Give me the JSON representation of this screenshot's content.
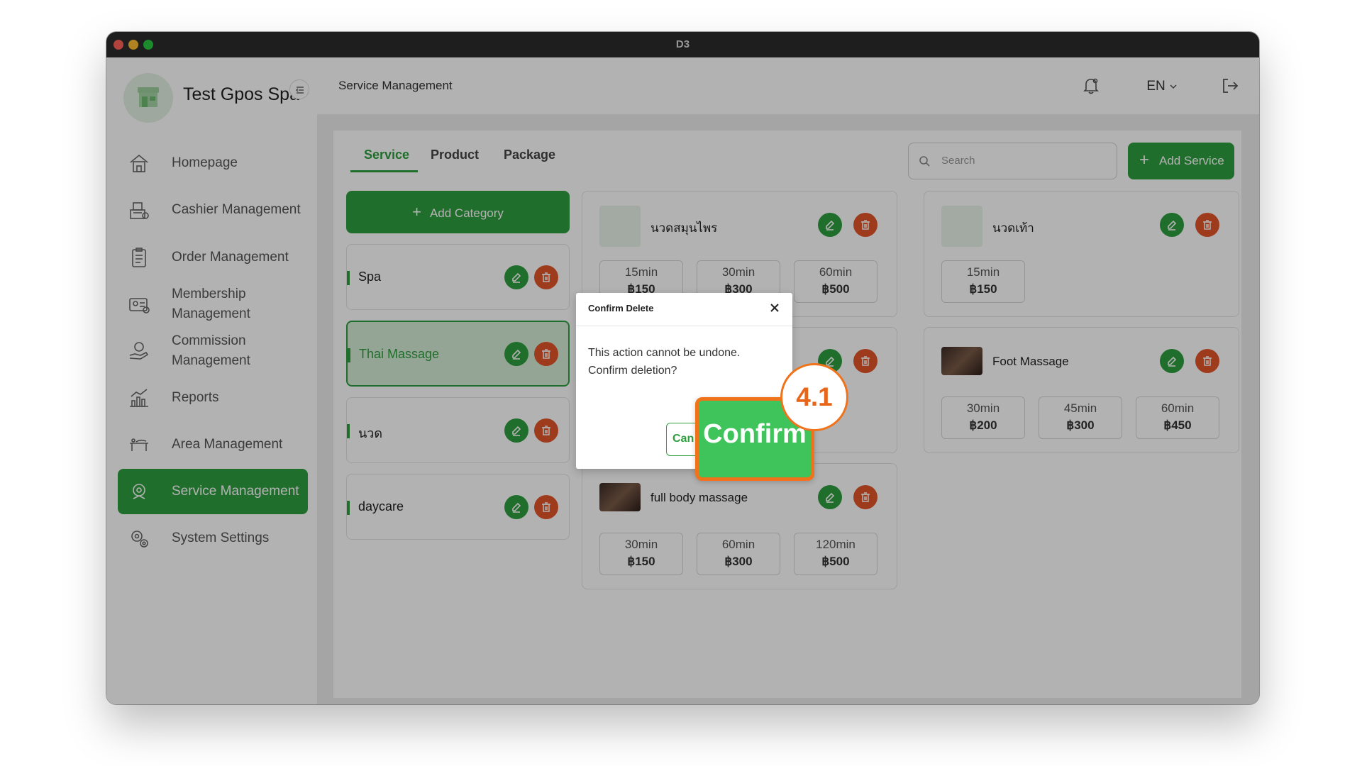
{
  "window": {
    "title": "D3"
  },
  "sidebar": {
    "brand": "Test Gpos Spa",
    "items": [
      {
        "label": "Homepage",
        "icon": "home-icon"
      },
      {
        "label": "Cashier Management",
        "icon": "cashier-icon"
      },
      {
        "label": "Order Management",
        "icon": "clipboard-icon"
      },
      {
        "label": "Membership Management",
        "icon": "membership-card-icon"
      },
      {
        "label": "Commission Management",
        "icon": "commission-hand-icon"
      },
      {
        "label": "Reports",
        "icon": "chart-icon"
      },
      {
        "label": "Area Management",
        "icon": "massage-bed-icon"
      },
      {
        "label": "Service Management",
        "icon": "service-icon",
        "active": true
      },
      {
        "label": "System Settings",
        "icon": "gear-icon"
      }
    ]
  },
  "header": {
    "title": "Service Management",
    "language": "EN"
  },
  "tabs": [
    "Service",
    "Product",
    "Package"
  ],
  "search": {
    "placeholder": "Search"
  },
  "add_service_label": "Add Service",
  "add_category_label": "Add Category",
  "categories": [
    {
      "name": "Spa"
    },
    {
      "name": "Thai Massage",
      "active": true
    },
    {
      "name": "นวด"
    },
    {
      "name": "daycare"
    }
  ],
  "services": [
    {
      "name": "นวดสมุนไพร",
      "options": [
        {
          "duration": "15min",
          "price": "฿150"
        },
        {
          "duration": "30min",
          "price": "฿300"
        },
        {
          "duration": "60min",
          "price": "฿500"
        }
      ]
    },
    {
      "name": "นวดเท้า",
      "options": [
        {
          "duration": "15min",
          "price": "฿150"
        }
      ]
    },
    {
      "name": "Foot Massage",
      "options": [
        {
          "duration": "30min",
          "price": "฿200"
        },
        {
          "duration": "45min",
          "price": "฿300"
        },
        {
          "duration": "60min",
          "price": "฿450"
        }
      ]
    },
    {
      "name": "full body massage",
      "options": [
        {
          "duration": "30min",
          "price": "฿150"
        },
        {
          "duration": "60min",
          "price": "฿300"
        },
        {
          "duration": "120min",
          "price": "฿500"
        }
      ]
    }
  ],
  "dialog": {
    "title": "Confirm Delete",
    "message_line1": "This action cannot be undone.",
    "message_line2": "Confirm deletion?",
    "cancel_label": "Can",
    "confirm_label": "Confirm"
  },
  "step_badge": "4.1",
  "colors": {
    "accent": "#2e9e3f",
    "delete": "#e2552a",
    "highlight": "#f0731c"
  }
}
